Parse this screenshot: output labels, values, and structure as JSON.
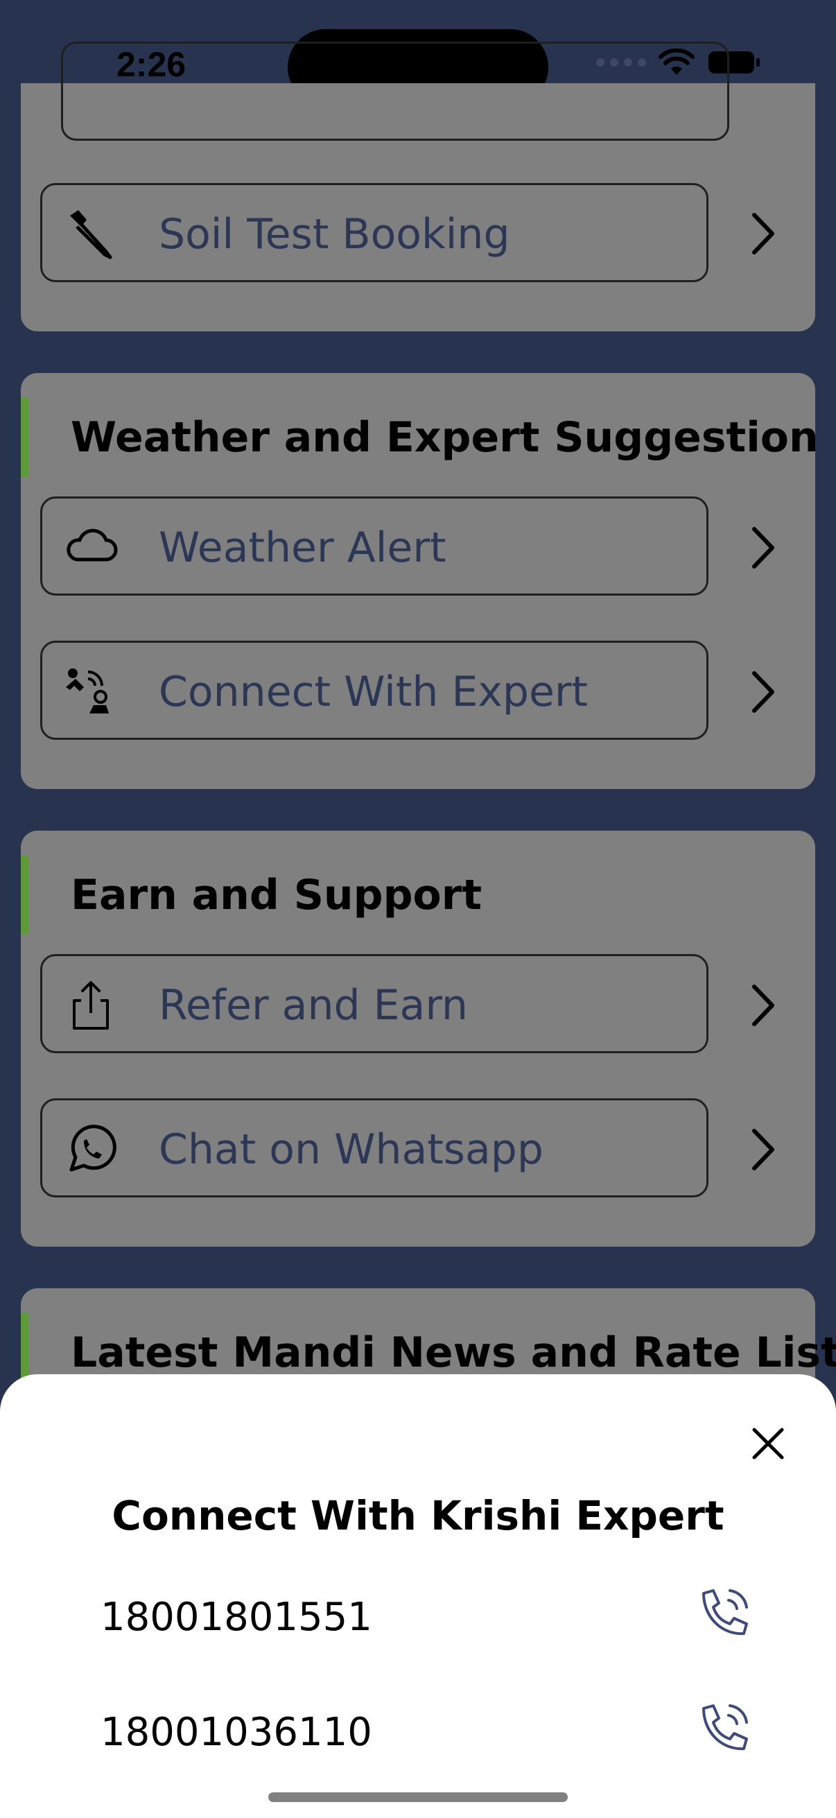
{
  "status_bar": {
    "time": "2:26"
  },
  "sections": {
    "soil": {
      "item": "Soil Test Booking"
    },
    "weather": {
      "title": "Weather and Expert Suggestion",
      "items": [
        "Weather Alert",
        "Connect With Expert"
      ]
    },
    "earn": {
      "title": "Earn and Support",
      "items": [
        "Refer and Earn",
        "Chat on Whatsapp"
      ]
    },
    "mandi": {
      "title": "Latest Mandi News and Rate List"
    }
  },
  "sheet": {
    "title": "Connect With Krishi Expert",
    "numbers": [
      "18001801551",
      "18001036110"
    ]
  },
  "colors": {
    "background": "#283350",
    "card": "#808080",
    "accent": "#5f9a3a",
    "label": "#2c3655",
    "call_icon": "#3d4a7a"
  }
}
